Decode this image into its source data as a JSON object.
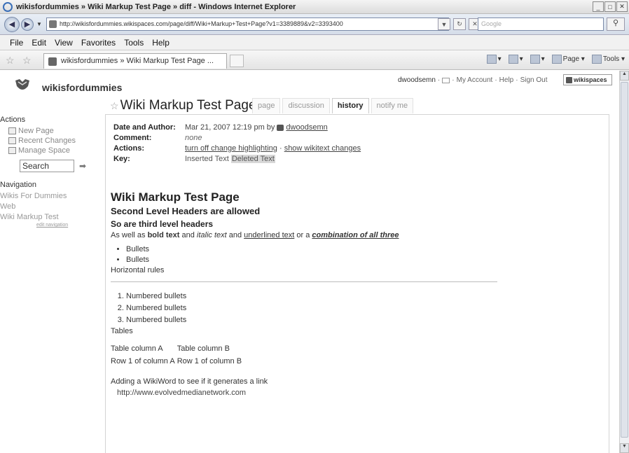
{
  "browser": {
    "window_title": "wikisfordummies » Wiki Markup Test Page » diff - Windows Internet Explorer",
    "url": "http://wikisfordummies.wikispaces.com/page/diff/Wiki+Markup+Test+Page?v1=3389889&v2=3393400",
    "search_placeholder": "Google",
    "menu": [
      "File",
      "Edit",
      "View",
      "Favorites",
      "Tools",
      "Help"
    ],
    "tab_title": "wikisfordummies » Wiki Markup Test Page ...",
    "cmd_page": "Page",
    "cmd_tools": "Tools"
  },
  "site": {
    "name": "wikisfordummies",
    "username": "dwoodsemn",
    "my_account": "My Account",
    "help": "Help",
    "sign_out": "Sign Out",
    "badge": "wikispaces"
  },
  "page": {
    "title": "Wiki Markup Test Page",
    "tabs": [
      {
        "label": "page",
        "active": false
      },
      {
        "label": "discussion",
        "active": false
      },
      {
        "label": "history",
        "active": true
      },
      {
        "label": "notify me",
        "active": false
      }
    ]
  },
  "sidebar": {
    "actions_heading": "Actions",
    "actions": [
      "New Page",
      "Recent Changes",
      "Manage Space"
    ],
    "search_value": "Search",
    "navigation_heading": "Navigation",
    "nav_links": [
      "Wikis For Dummies",
      "Web",
      "Wiki Markup Test"
    ],
    "edit_navigation": "edit navigation"
  },
  "diff": {
    "date_label": "Date and Author:",
    "date_value": "Mar 21, 2007 12:19 pm by",
    "author": "dwoodsemn",
    "comment_label": "Comment:",
    "comment_value": "none",
    "actions_label": "Actions:",
    "action_1": "turn off change highlighting",
    "action_2": "show wikitext changes",
    "key_label": "Key:",
    "key_inserted": "Inserted Text",
    "key_deleted": "Deleted Text"
  },
  "wiki": {
    "h1": "Wiki Markup Test Page",
    "h2": "Second Level Headers are allowed",
    "h3": "So are third level headers",
    "p_intro_1": "As well as ",
    "p_bold": "bold text",
    "p_intro_2": " and ",
    "p_italic": "italic text",
    "p_intro_3": " and ",
    "p_underline": "underlined text",
    "p_intro_4": " or a ",
    "p_combo": "combination of all three",
    "bullets": [
      "Bullets",
      "Bullets"
    ],
    "hr_label": "Horizontal rules",
    "numbered": [
      "Numbered bullets",
      "Numbered bullets",
      "Numbered bullets"
    ],
    "tables_label": "Tables",
    "table": [
      [
        "Table column A",
        "Table column B"
      ],
      [
        "Row 1 of column A",
        "Row 1 of column B"
      ]
    ],
    "wikiword_text": "Adding a WikiWord to see if it generates a link",
    "link_text": "http://www.evolvedmedianetwork.com"
  }
}
